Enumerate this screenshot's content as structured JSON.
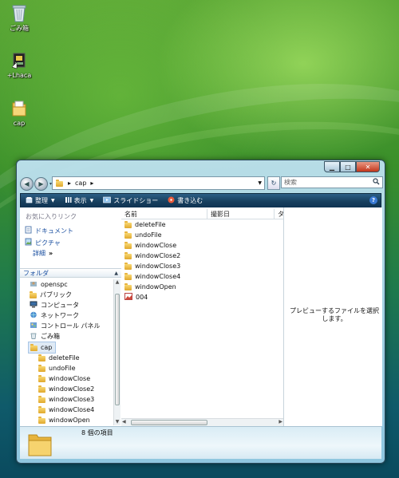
{
  "desktop": {
    "icons": [
      {
        "label": "ごみ箱",
        "icon": "recycle-bin-icon"
      },
      {
        "label": "+Lhaca",
        "icon": "lhaca-app-icon"
      },
      {
        "label": "cap",
        "icon": "folder-icon"
      }
    ]
  },
  "window": {
    "address": {
      "path_separator": "▸",
      "folder": "cap",
      "trail": "▸"
    },
    "search_placeholder": "検索",
    "toolbar": {
      "organize": "整理",
      "views": "表示",
      "slideshow": "スライドショー",
      "burn": "書き込む"
    },
    "favorites": {
      "title": "お気に入りリンク",
      "items": [
        "ドキュメント",
        "ピクチャ"
      ],
      "more": "詳細",
      "more_arrow": "»"
    },
    "folders": {
      "title": "フォルダ",
      "items": [
        {
          "label": "openspc",
          "icon": "user-folder-icon"
        },
        {
          "label": "パブリック",
          "icon": "folder-icon"
        },
        {
          "label": "コンピュータ",
          "icon": "computer-icon"
        },
        {
          "label": "ネットワーク",
          "icon": "network-icon"
        },
        {
          "label": "コントロール パネル",
          "icon": "control-panel-icon"
        },
        {
          "label": "ごみ箱",
          "icon": "recycle-bin-icon"
        },
        {
          "label": "cap",
          "icon": "folder-icon",
          "selected": true
        },
        {
          "label": "deleteFile",
          "icon": "folder-icon"
        },
        {
          "label": "undoFile",
          "icon": "folder-icon"
        },
        {
          "label": "windowClose",
          "icon": "folder-icon"
        },
        {
          "label": "windowClose2",
          "icon": "folder-icon"
        },
        {
          "label": "windowClose3",
          "icon": "folder-icon"
        },
        {
          "label": "windowClose4",
          "icon": "folder-icon"
        },
        {
          "label": "windowOpen",
          "icon": "folder-icon"
        }
      ]
    },
    "columns": [
      "名前",
      "撮影日",
      "タ"
    ],
    "files": [
      {
        "name": "deleteFile",
        "icon": "folder-icon"
      },
      {
        "name": "undoFile",
        "icon": "folder-icon"
      },
      {
        "name": "windowClose",
        "icon": "folder-icon"
      },
      {
        "name": "windowClose2",
        "icon": "folder-icon"
      },
      {
        "name": "windowClose3",
        "icon": "folder-icon"
      },
      {
        "name": "windowClose4",
        "icon": "folder-icon"
      },
      {
        "name": "windowOpen",
        "icon": "folder-icon"
      },
      {
        "name": "004",
        "icon": "image-file-icon"
      }
    ],
    "preview_text": "プレビューするファイルを選択します。",
    "details": {
      "count": "8 個の項目"
    }
  }
}
